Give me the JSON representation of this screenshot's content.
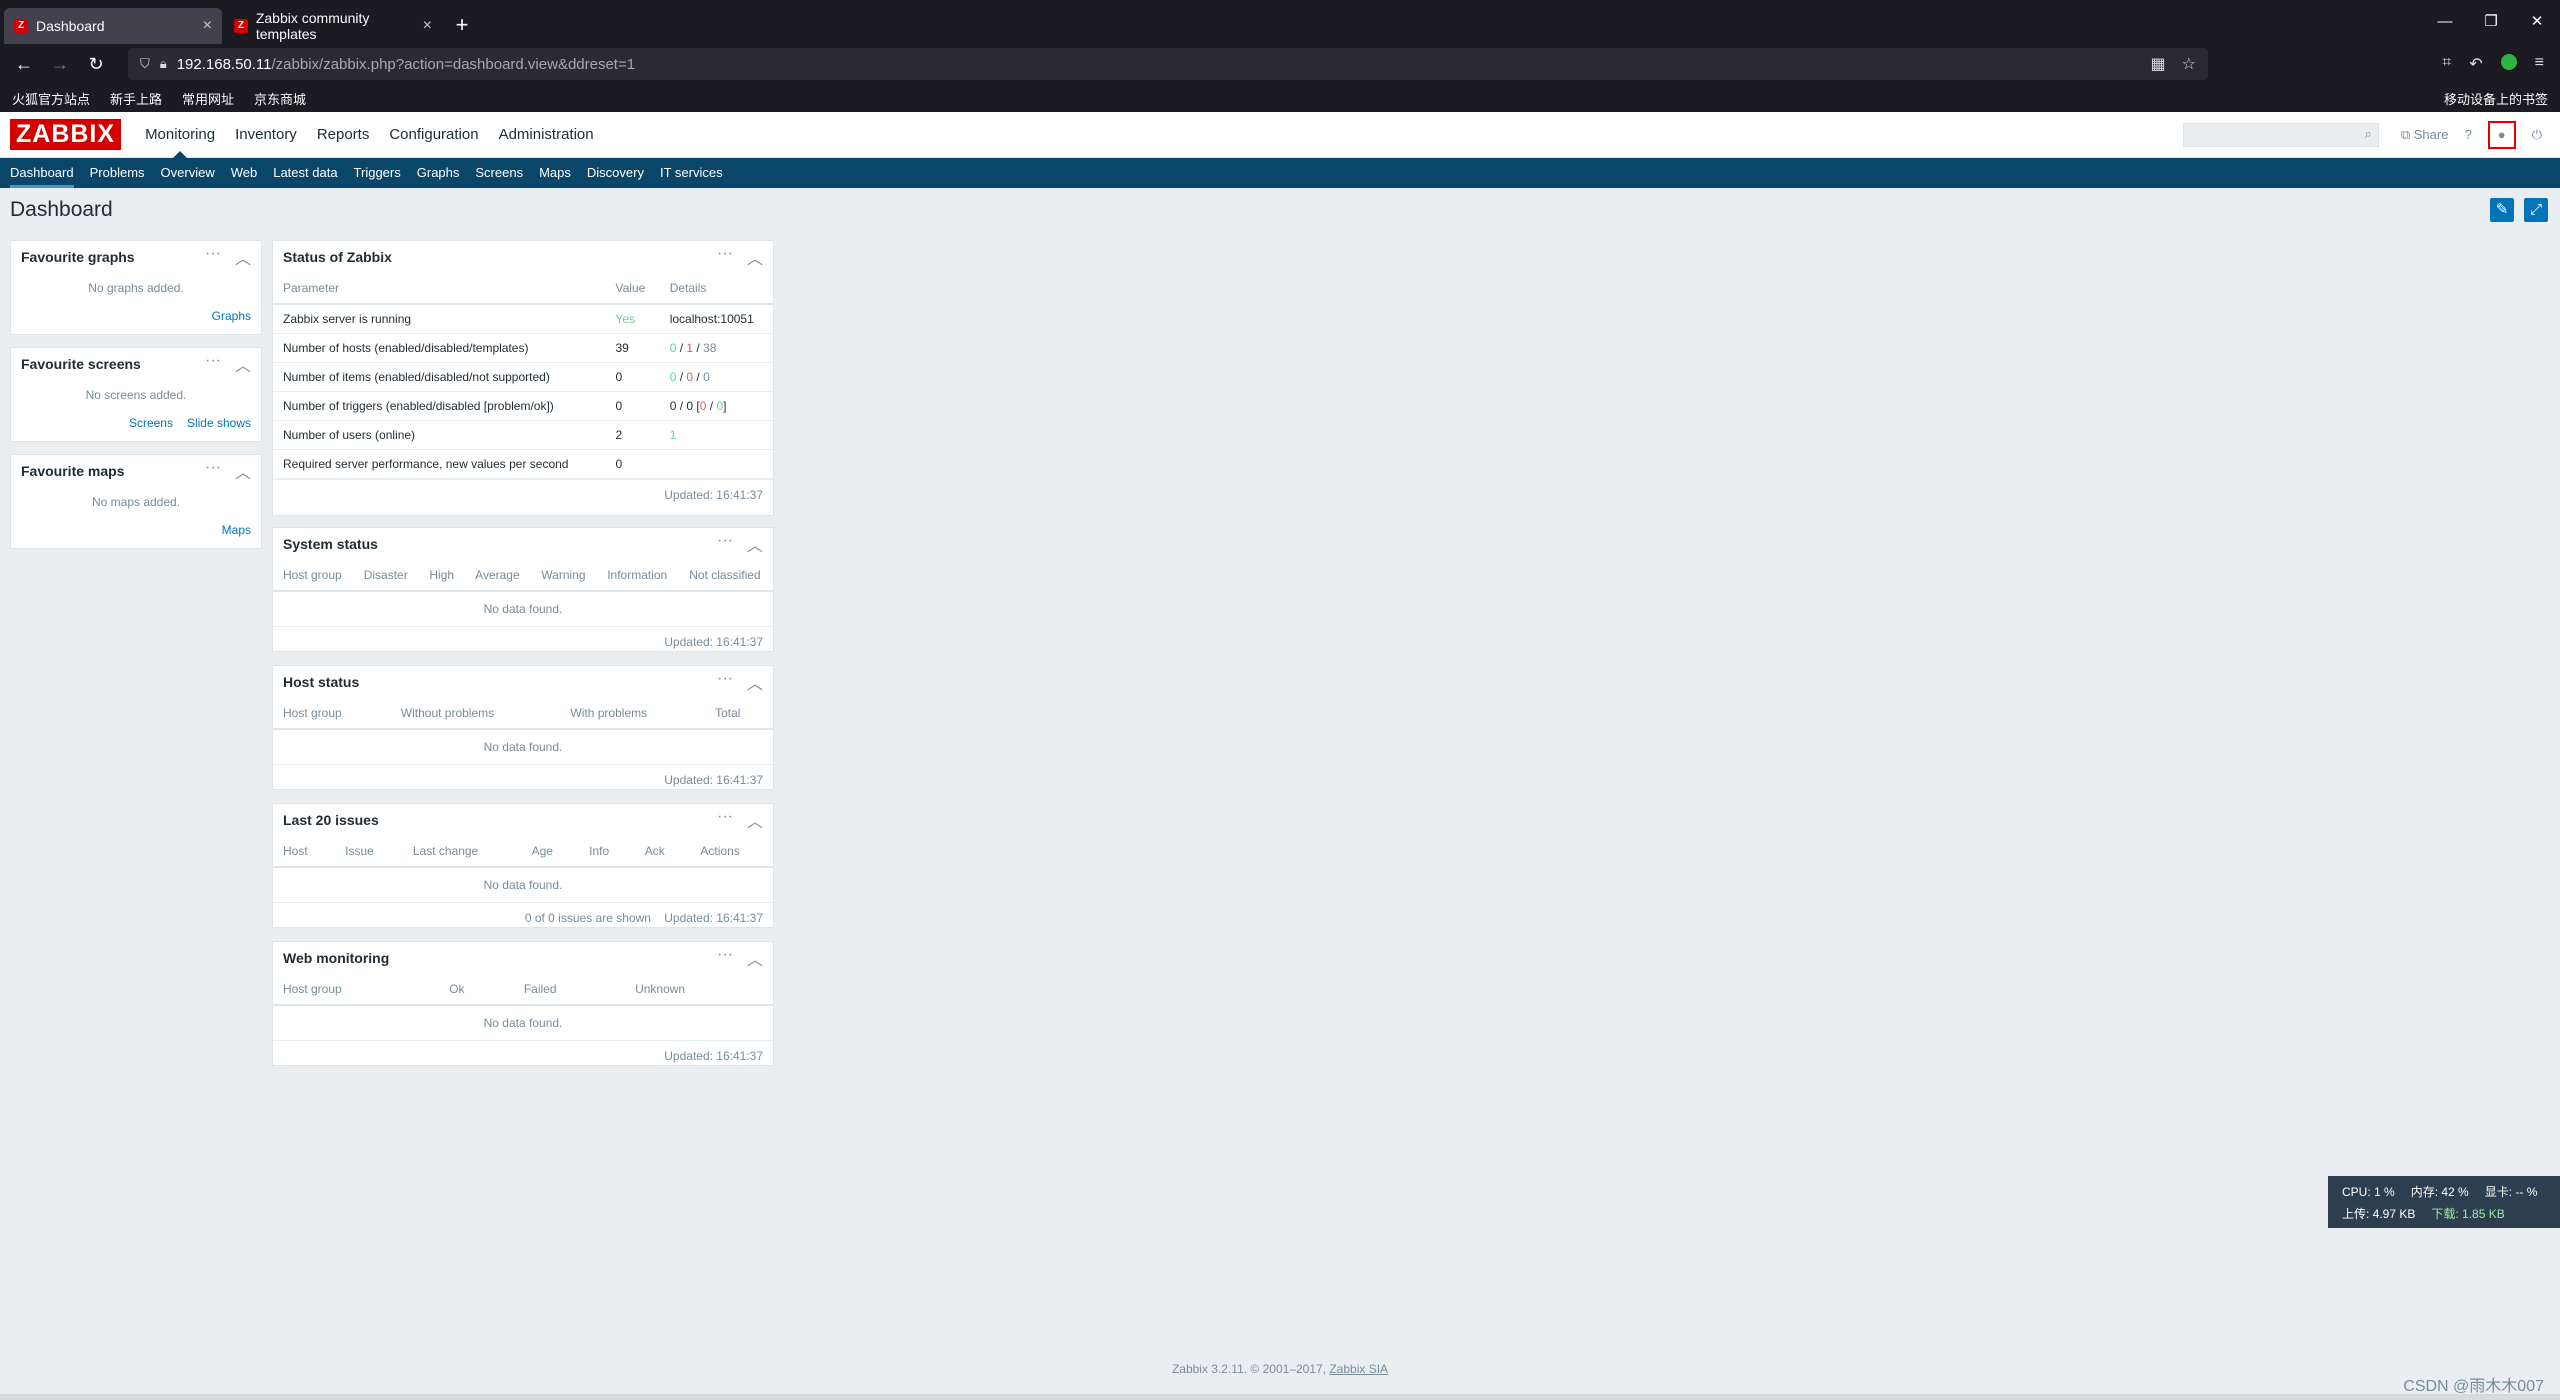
{
  "browser": {
    "tabs": [
      {
        "label": "Dashboard"
      },
      {
        "label": "Zabbix community templates"
      }
    ],
    "url_host": "192.168.50.11",
    "url_path": "/zabbix/zabbix.php?action=dashboard.view&ddreset=1",
    "bookmarks": [
      "火狐官方站点",
      "新手上路",
      "常用网址",
      "京东商城"
    ],
    "mobile_bookmarks": "移动设备上的书签"
  },
  "zabbix": {
    "logo": "ZABBIX",
    "menu": [
      "Monitoring",
      "Inventory",
      "Reports",
      "Configuration",
      "Administration"
    ],
    "share": "Share",
    "help": "?",
    "submenu": [
      "Dashboard",
      "Problems",
      "Overview",
      "Web",
      "Latest data",
      "Triggers",
      "Graphs",
      "Screens",
      "Maps",
      "Discovery",
      "IT services"
    ],
    "page_title": "Dashboard"
  },
  "fav_graphs": {
    "title": "Favourite graphs",
    "empty": "No graphs added.",
    "links": [
      "Graphs"
    ]
  },
  "fav_screens": {
    "title": "Favourite screens",
    "empty": "No screens added.",
    "links": [
      "Screens",
      "Slide shows"
    ]
  },
  "fav_maps": {
    "title": "Favourite maps",
    "empty": "No maps added.",
    "links": [
      "Maps"
    ]
  },
  "status": {
    "title": "Status of Zabbix",
    "headers": [
      "Parameter",
      "Value",
      "Details"
    ],
    "rows": [
      {
        "param": "Zabbix server is running",
        "value": "Yes",
        "details": "localhost:10051"
      },
      {
        "param": "Number of hosts (enabled/disabled/templates)",
        "value": "39",
        "d1": "0",
        "d2": "1",
        "d3": "38"
      },
      {
        "param": "Number of items (enabled/disabled/not supported)",
        "value": "0",
        "d1": "0",
        "d2": "0",
        "d3": "0"
      },
      {
        "param": "Number of triggers (enabled/disabled [problem/ok])",
        "value": "0",
        "d1": "0",
        "d2": "0",
        "d3": "0",
        "d4": "0"
      },
      {
        "param": "Number of users (online)",
        "value": "2",
        "details": "1"
      },
      {
        "param": "Required server performance, new values per second",
        "value": "0",
        "details": ""
      }
    ],
    "updated": "Updated: 16:41:37"
  },
  "system_status": {
    "title": "System status",
    "headers": [
      "Host group",
      "Disaster",
      "High",
      "Average",
      "Warning",
      "Information",
      "Not classified"
    ],
    "empty": "No data found.",
    "updated": "Updated: 16:41:37"
  },
  "host_status": {
    "title": "Host status",
    "headers": [
      "Host group",
      "Without problems",
      "With problems",
      "Total"
    ],
    "empty": "No data found.",
    "updated": "Updated: 16:41:37"
  },
  "last_issues": {
    "title": "Last 20 issues",
    "headers": [
      "Host",
      "Issue",
      "Last change",
      "Age",
      "Info",
      "Ack",
      "Actions"
    ],
    "empty": "No data found.",
    "shown": "0 of 0 issues are shown",
    "updated": "Updated: 16:41:37"
  },
  "web_monitoring": {
    "title": "Web monitoring",
    "headers": [
      "Host group",
      "Ok",
      "Failed",
      "Unknown"
    ],
    "empty": "No data found.",
    "updated": "Updated: 16:41:37"
  },
  "footer": {
    "text": "Zabbix 3.2.11. © 2001–2017, ",
    "link": "Zabbix SIA"
  },
  "sysmon": {
    "cpu": "CPU: 1 %",
    "mem": "内存: 42 %",
    "gpu": "显卡: -- %",
    "up": "上传: 4.97 KB",
    "down": "下载: 1.85 KB"
  },
  "watermark": "CSDN @雨木木007"
}
